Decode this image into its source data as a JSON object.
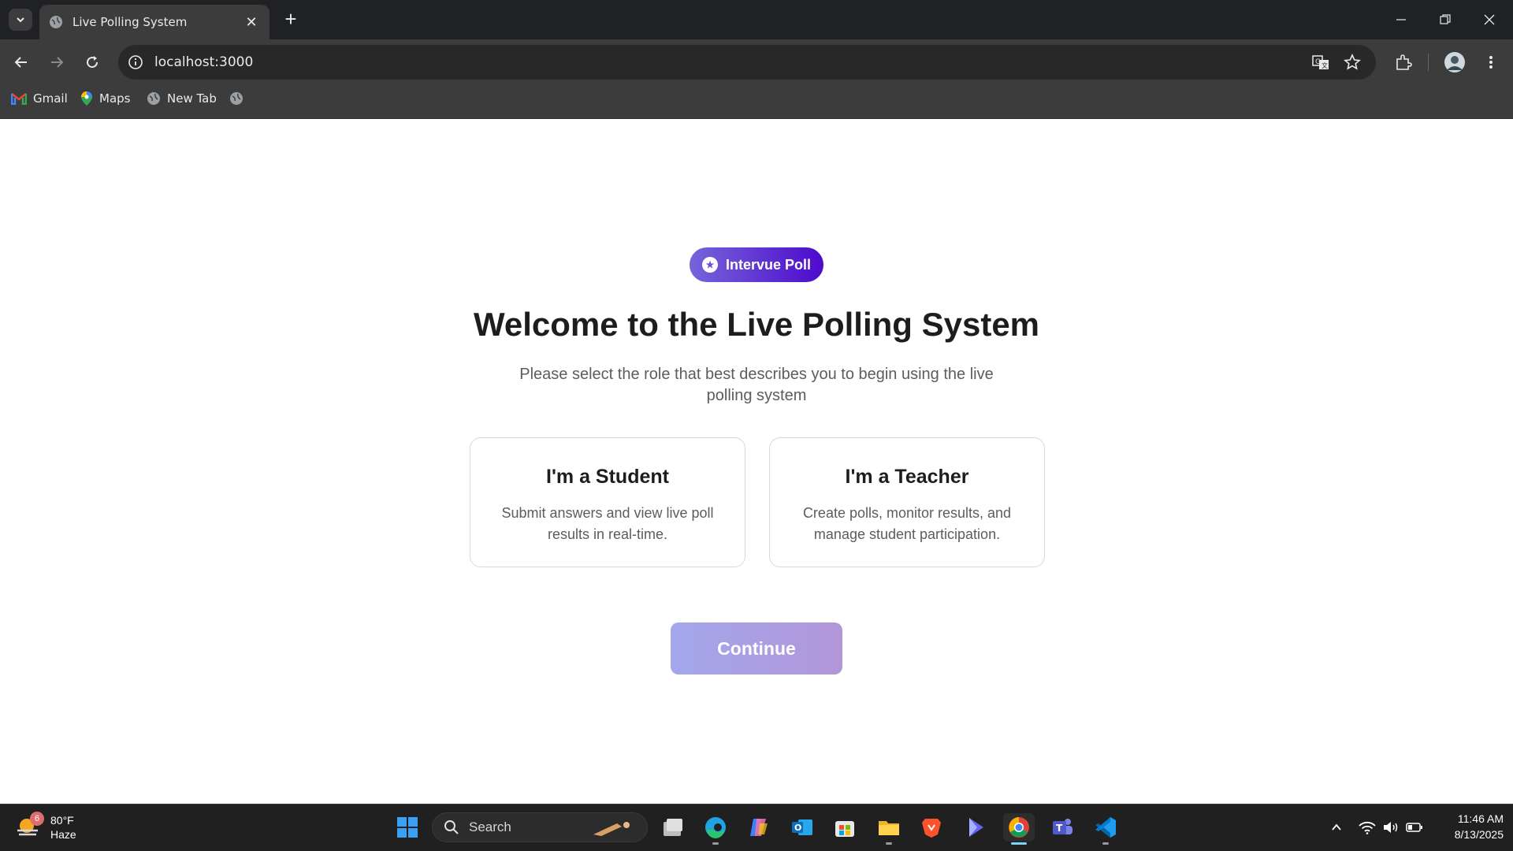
{
  "browser": {
    "tab_title": "Live Polling System",
    "url": "localhost:3000",
    "bookmarks": [
      "Gmail",
      "Maps",
      "New Tab"
    ]
  },
  "page": {
    "badge_label": "Intervue Poll",
    "headline": "Welcome to the Live Polling System",
    "subtext": "Please select the role that best describes you to begin using the live polling system",
    "roles": [
      {
        "title": "I'm a Student",
        "description": "Submit answers and view live poll results in real-time."
      },
      {
        "title": "I'm a Teacher",
        "description": "Create polls, monitor results, and manage student participation."
      }
    ],
    "continue_label": "Continue",
    "colors": {
      "badge_start": "#7565d9",
      "badge_end": "#4d0acd",
      "continue_start": "#a3a7ec",
      "continue_end": "#b296d9"
    }
  },
  "taskbar": {
    "weather_badge": "6",
    "temperature": "80°F",
    "condition": "Haze",
    "search_label": "Search",
    "time": "11:46 AM",
    "date": "8/13/2025",
    "apps": [
      "start-icon",
      "task-view-icon",
      "edge-icon",
      "copilot-icon",
      "outlook-icon",
      "store-icon",
      "file-explorer-icon",
      "brave-icon",
      "app-icon",
      "chrome-icon",
      "teams-icon",
      "vscode-icon"
    ]
  }
}
